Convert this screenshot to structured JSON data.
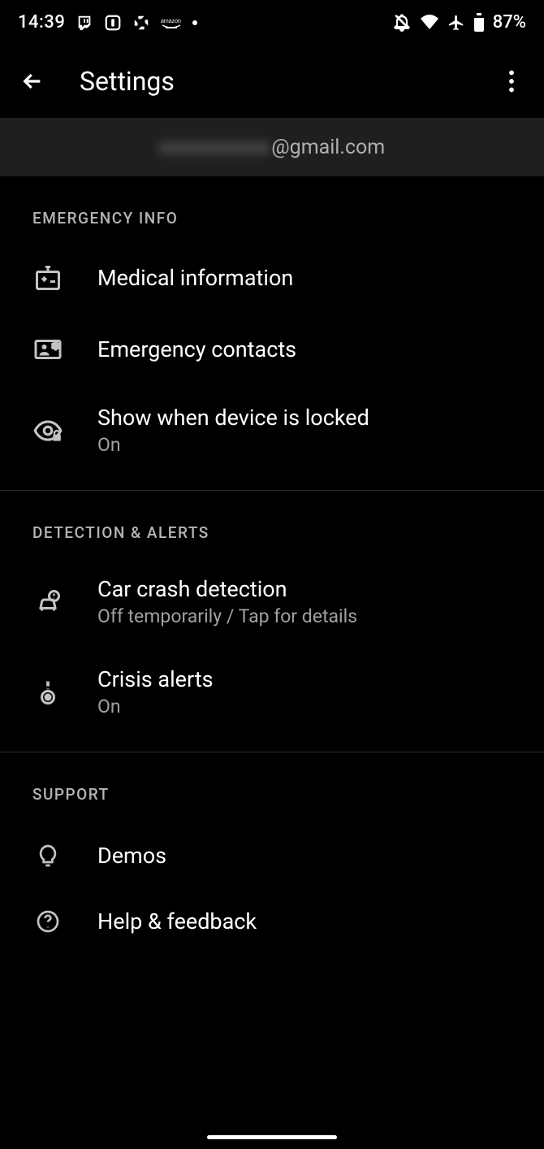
{
  "status_bar": {
    "time": "14:39",
    "battery": "87%"
  },
  "app_bar": {
    "title": "Settings"
  },
  "account": {
    "email_blurred": "xxxxxxxxxxx",
    "email_domain": "@gmail.com"
  },
  "sections": [
    {
      "header": "EMERGENCY INFO",
      "items": [
        {
          "title": "Medical information",
          "subtitle": ""
        },
        {
          "title": "Emergency contacts",
          "subtitle": ""
        },
        {
          "title": "Show when device is locked",
          "subtitle": "On"
        }
      ]
    },
    {
      "header": "DETECTION & ALERTS",
      "items": [
        {
          "title": "Car crash detection",
          "subtitle": "Off temporarily / Tap for details"
        },
        {
          "title": "Crisis alerts",
          "subtitle": "On"
        }
      ]
    },
    {
      "header": "SUPPORT",
      "items": [
        {
          "title": "Demos",
          "subtitle": ""
        },
        {
          "title": "Help & feedback",
          "subtitle": ""
        }
      ]
    }
  ]
}
